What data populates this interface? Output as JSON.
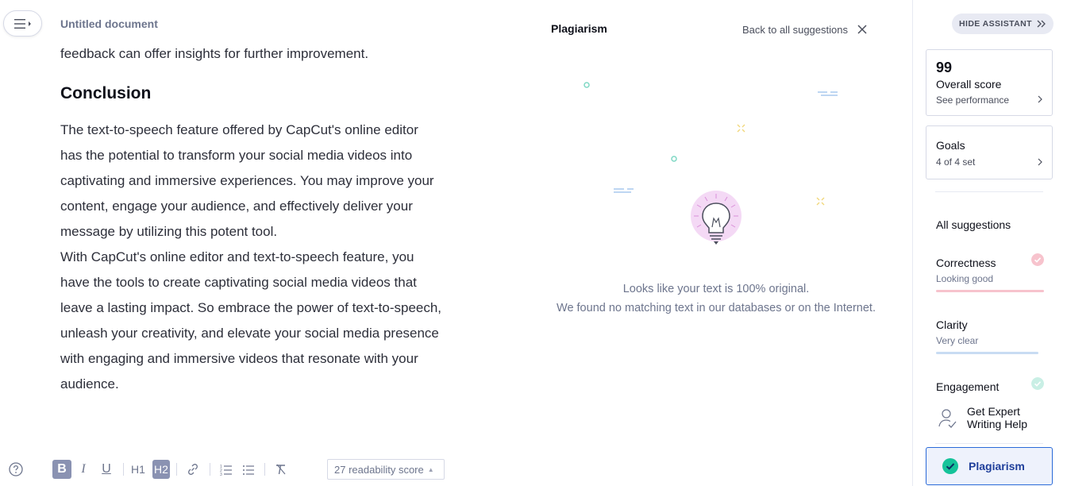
{
  "document": {
    "title": "Untitled document",
    "top_fragment": "feedback can offer insights for further improvement.",
    "heading": "Conclusion",
    "paragraph1_lines": [
      "The text-to-speech feature offered by CapCut's online editor",
      "has the potential to transform your social media videos into",
      "captivating and immersive experiences. You may improve your",
      "content, engage your audience, and effectively deliver your",
      "message by utilizing this potent tool."
    ],
    "paragraph2_lines": [
      "With CapCut's online editor and text-to-speech feature, you",
      "have the tools to create captivating social media videos that",
      "leave a lasting impact. So embrace the power of text-to-speech,",
      "unleash your creativity, and elevate your social media presence",
      "with engaging and immersive videos that resonate with your",
      "audience."
    ]
  },
  "plagiarism_panel": {
    "title": "Plagiarism",
    "back_link": "Back to all suggestions",
    "message_line1": "Looks like your text is 100% original.",
    "message_line2": "We found no matching text in our databases or on the Internet."
  },
  "toolbar": {
    "bold": "B",
    "italic": "I",
    "underline": "U",
    "h1": "H1",
    "h2": "H2",
    "readability": "27 readability score"
  },
  "sidebar": {
    "hide_button": "HIDE ASSISTANT",
    "score": {
      "value": "99",
      "label": "Overall score",
      "link": "See performance"
    },
    "goals": {
      "label": "Goals",
      "link": "4 of 4 set"
    },
    "all_suggestions": "All suggestions",
    "categories": [
      {
        "name": "Correctness",
        "status": "Looking good",
        "color": "#f2a7b6"
      },
      {
        "name": "Clarity",
        "status": "Very clear",
        "color": "#a9c8ee"
      },
      {
        "name": "Engagement",
        "status": "",
        "color": "#a8e6d6"
      }
    ],
    "expert_help": "Get Expert Writing Help",
    "plagiarism_tab": "Plagiarism"
  },
  "colors": {
    "accent_blue": "#2a6ad8",
    "plagiarism_check": "#15c39a",
    "bulb_glow": "#f4d9f5"
  }
}
